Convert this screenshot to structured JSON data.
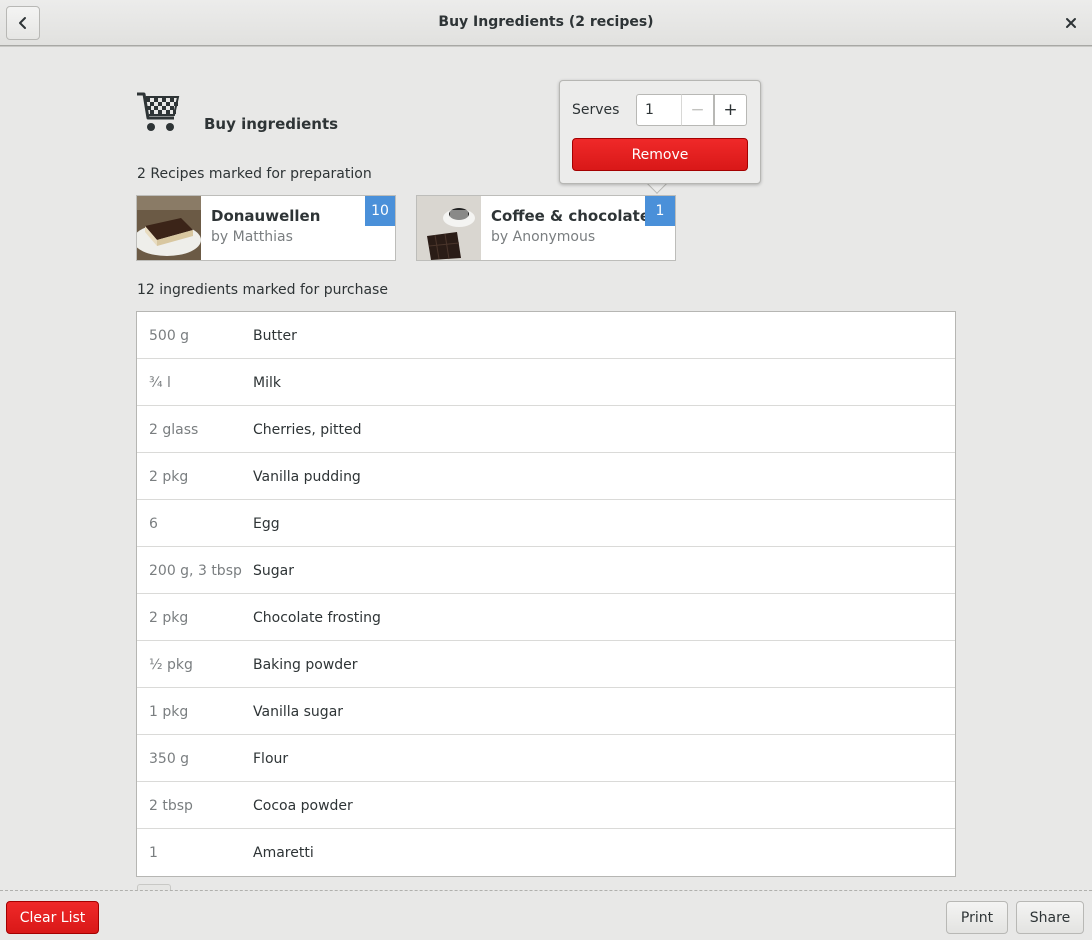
{
  "header": {
    "title": "Buy Ingredients (2 recipes)",
    "back_icon": "chevron-left-icon",
    "close_icon": "close-icon",
    "close_glyph": "✕"
  },
  "main": {
    "heading": "Buy ingredients",
    "heading_icon": "shopping-cart-icon",
    "recipes_label": "2 Recipes marked for preparation",
    "ingredients_label": "12 ingredients marked for purchase"
  },
  "recipes": [
    {
      "name": "Donauwellen",
      "author": "by Matthias",
      "serves": "10"
    },
    {
      "name": "Coffee & chocolate",
      "author": "by Anonymous",
      "serves": "1"
    }
  ],
  "popover": {
    "serves_label": "Serves",
    "serves_value": "1",
    "minus_glyph": "−",
    "plus_glyph": "+",
    "remove_label": "Remove"
  },
  "ingredients": [
    {
      "amount": "500 g",
      "name": "Butter"
    },
    {
      "amount": "¾ l",
      "name": "Milk"
    },
    {
      "amount": "2 glass",
      "name": "Cherries, pitted"
    },
    {
      "amount": "2 pkg",
      "name": "Vanilla pudding"
    },
    {
      "amount": "6",
      "name": "Egg"
    },
    {
      "amount": "200 g, 3 tbsp",
      "name": "Sugar"
    },
    {
      "amount": "2 pkg",
      "name": "Chocolate frosting"
    },
    {
      "amount": "½ pkg",
      "name": "Baking powder"
    },
    {
      "amount": "1 pkg",
      "name": "Vanilla sugar"
    },
    {
      "amount": "350 g",
      "name": "Flour"
    },
    {
      "amount": "2 tbsp",
      "name": "Cocoa powder"
    },
    {
      "amount": "1",
      "name": "Amaretti"
    }
  ],
  "actions": {
    "clear_label": "Clear List",
    "print_label": "Print",
    "share_label": "Share"
  },
  "colors": {
    "destructive": "#e01b1b",
    "badge": "#4a90d9",
    "background": "#e8e8e7"
  }
}
